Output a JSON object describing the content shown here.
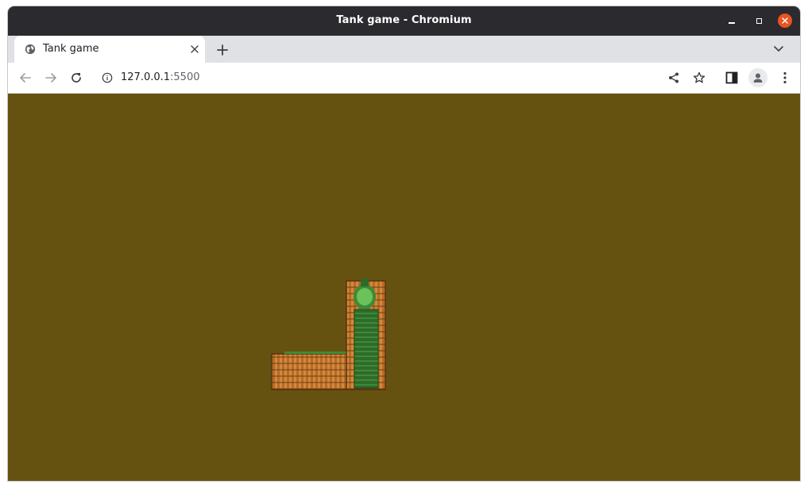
{
  "window": {
    "title": "Tank game - Chromium"
  },
  "tabs": [
    {
      "label": "Tank game",
      "icon": "globe-icon",
      "active": true
    }
  ],
  "toolbar": {
    "url_host": "127.0.0.1",
    "url_port": ":5500"
  },
  "page": {
    "background": "#655210",
    "game": {
      "wall_color": "#c0742c",
      "tank_color": "#2e6b2a",
      "turret_color": "#5fb04a"
    }
  },
  "colors": {
    "titlebar": "#2b2a2e",
    "close_button": "#e95420",
    "tabstrip": "#dfe1e5"
  }
}
